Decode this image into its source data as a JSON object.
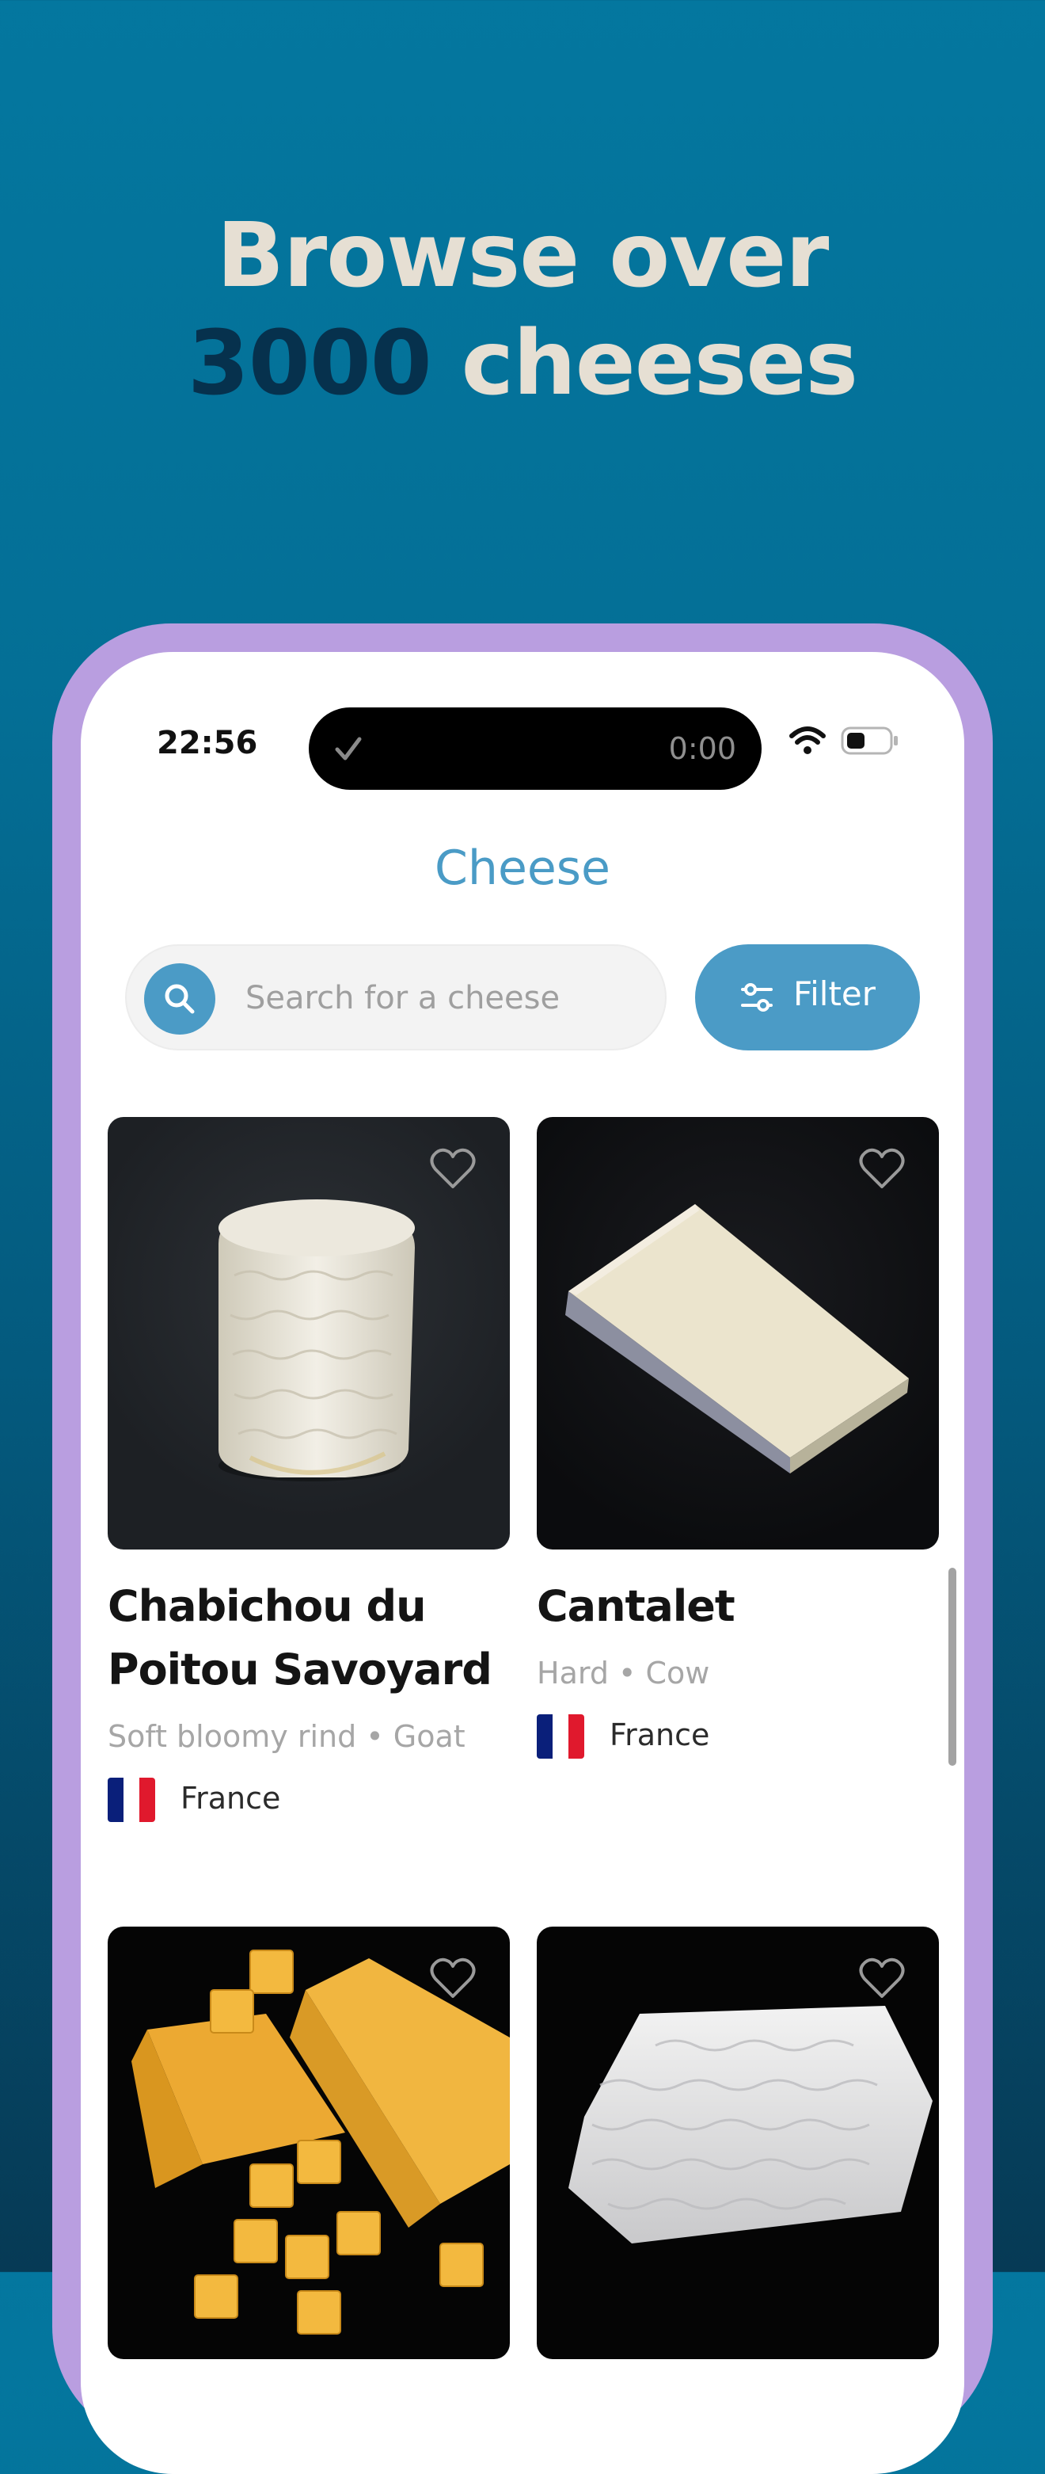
{
  "headline": {
    "line1": "Browse over",
    "highlight": "3000",
    "line2_rest": " cheeses"
  },
  "status_bar": {
    "time": "22:56",
    "island_timer": "0:00"
  },
  "app": {
    "title": "Cheese",
    "search_placeholder": "Search for a cheese",
    "filter_label": "Filter"
  },
  "cards": [
    {
      "name": "Chabichou du Poitou Savoyard",
      "subtitle": "Soft bloomy rind • Goat",
      "country": "France"
    },
    {
      "name": "Cantalet",
      "subtitle": "Hard • Cow",
      "country": "France"
    },
    {
      "name": "",
      "subtitle": "",
      "country": ""
    },
    {
      "name": "",
      "subtitle": "",
      "country": ""
    }
  ],
  "colors": {
    "accent": "#4b9bc6",
    "phone_frame": "#b99ee0",
    "headline": "#e6dfd3",
    "headline_highlight": "#06314d"
  },
  "icons": [
    "search-icon",
    "filter-icon",
    "heart-icon",
    "wifi-icon",
    "battery-icon",
    "check-icon"
  ]
}
